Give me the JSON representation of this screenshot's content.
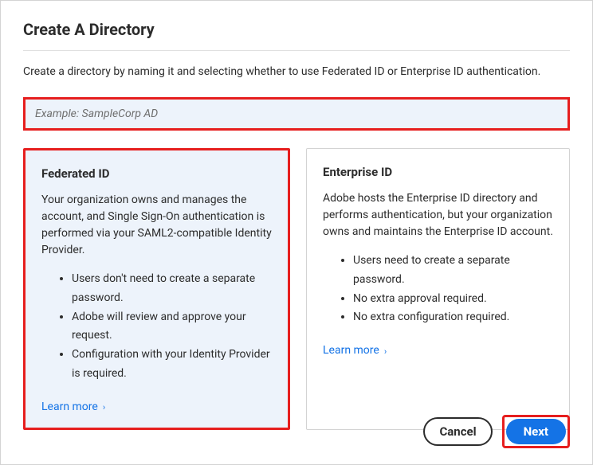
{
  "title": "Create A Directory",
  "description": "Create a directory by naming it and selecting whether to use Federated ID or Enterprise ID authentication.",
  "input": {
    "placeholder": "Example: SampleCorp AD",
    "value": ""
  },
  "cards": {
    "federated": {
      "title": "Federated ID",
      "text": "Your organization owns and manages the account, and Single Sign-On authentication is performed via your SAML2-compatible Identity Provider.",
      "bullets": [
        "Users don't need to create a separate password.",
        "Adobe will review and approve your request.",
        "Configuration with your Identity Provider is required."
      ],
      "learn_more": "Learn more"
    },
    "enterprise": {
      "title": "Enterprise ID",
      "text": "Adobe hosts the Enterprise ID directory and performs authentication, but your organization owns and maintains the Enterprise ID account.",
      "bullets": [
        "Users need to create a separate password.",
        "No extra approval required.",
        "No extra configuration required."
      ],
      "learn_more": "Learn more"
    }
  },
  "buttons": {
    "cancel": "Cancel",
    "next": "Next"
  }
}
